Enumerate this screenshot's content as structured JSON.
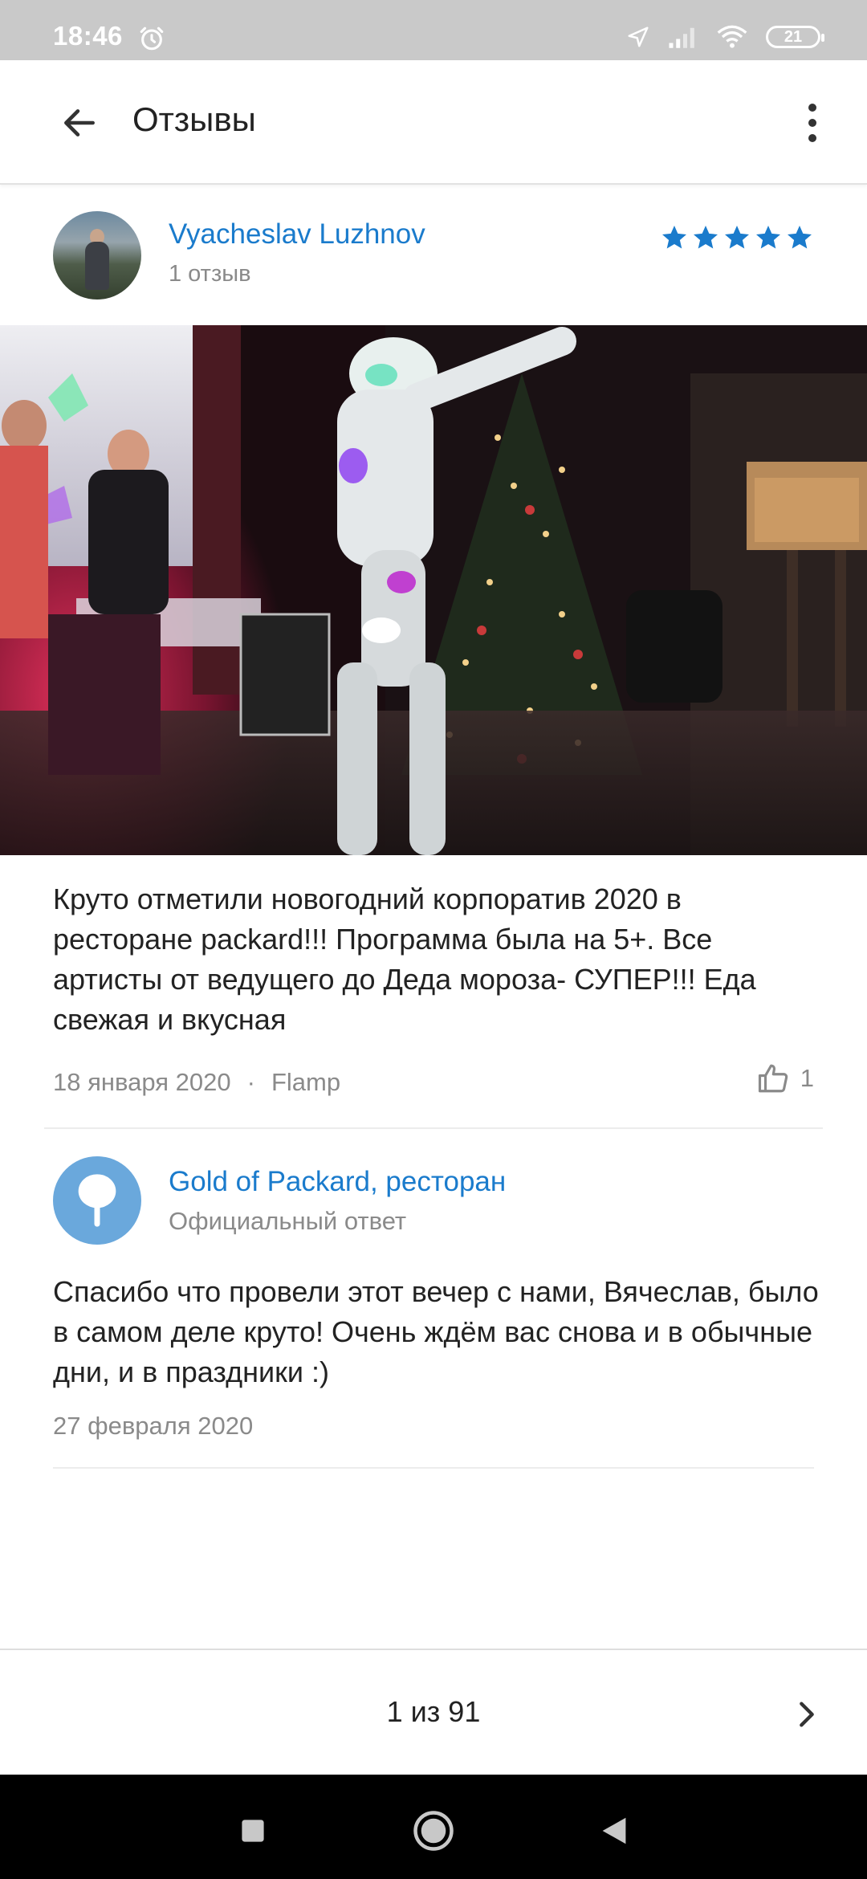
{
  "status_bar": {
    "time": "18:46",
    "battery": "21",
    "icons": [
      "alarm-icon",
      "location-icon",
      "signal-icon",
      "wifi-icon",
      "battery-icon"
    ]
  },
  "app_bar": {
    "title": "Отзывы",
    "back_icon": "arrow-left-icon",
    "more_icon": "more-vertical-icon"
  },
  "review": {
    "author": "Vyacheslav Luzhnov",
    "author_reviews": "1 отзыв",
    "rating": 5,
    "rating_color": "#1a7bcc",
    "text": "Круто отметили новогодний корпоратив 2020 в ресторане packard!!! Программа была на 5+. Все артисты от ведущего до Деда мороза- СУПЕР!!! Еда свежая и вкусная",
    "date": "18 января 2020",
    "dot": "·",
    "source": "Flamp",
    "likes": "1",
    "like_icon": "thumbs-up-icon"
  },
  "answer": {
    "org_name": "Gold of Packard, ресторан",
    "subtitle": "Официальный ответ",
    "text": "Спасибо что провели этот вечер с нами, Вячеслав, было в самом деле круто! Очень ждём вас снова и в обычные дни, и в праздники :)",
    "date": "27 февраля 2020",
    "logo_color": "#6aa8dc"
  },
  "pager": {
    "text": "1 из 91",
    "next_icon": "chevron-right-icon"
  },
  "nav_bar": {
    "buttons": [
      "recents-square-icon",
      "home-circle-icon",
      "back-triangle-icon"
    ]
  },
  "colors": {
    "accent": "#1a7bcc",
    "status_bar": "#c9c9c9",
    "secondary_text": "#8a8a8a"
  }
}
